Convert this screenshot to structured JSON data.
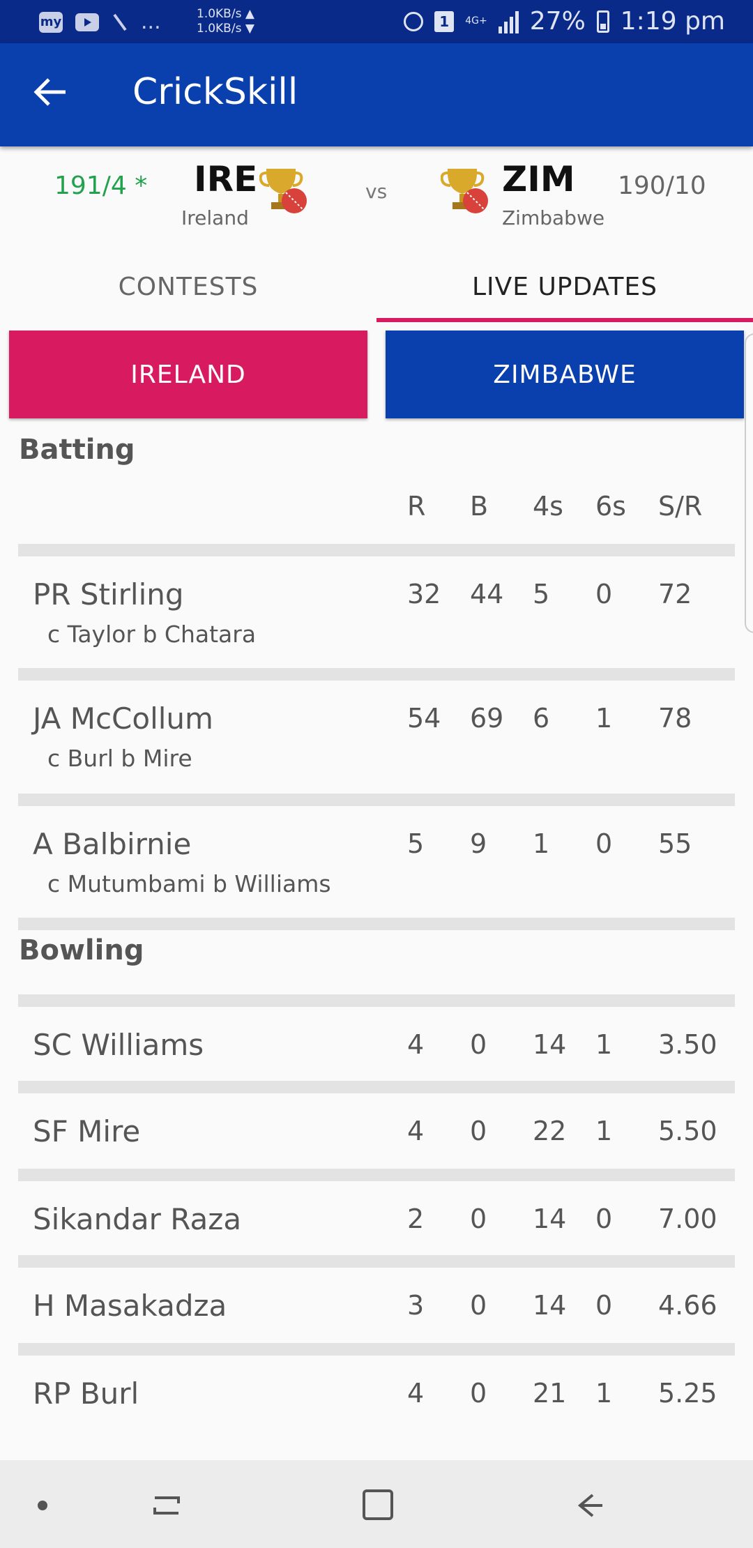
{
  "status_bar": {
    "app_badge": "my",
    "ellipsis": "...",
    "upload_speed": "1.0KB/s ▲",
    "download_speed": "1.0KB/s ▼",
    "sim_slot": "1",
    "network": "4G+",
    "battery": "27%",
    "time": "1:19 pm"
  },
  "app_bar": {
    "title": "CrickSkill"
  },
  "match": {
    "team1": {
      "score": "191/4 *",
      "code": "IRE",
      "name": "Ireland"
    },
    "vs": "vs",
    "team2": {
      "score": "190/10",
      "code": "ZIM",
      "name": "Zimbabwe"
    }
  },
  "tabs": [
    {
      "label": "CONTESTS",
      "active": false
    },
    {
      "label": "LIVE UPDATES",
      "active": true
    }
  ],
  "team_buttons": {
    "ireland": "IRELAND",
    "zimbabwe": "ZIMBABWE"
  },
  "batting": {
    "title": "Batting",
    "headers": [
      "R",
      "B",
      "4s",
      "6s",
      "S/R"
    ],
    "rows": [
      {
        "name": "PR Stirling",
        "dismissal": "c  Taylor b Chatara",
        "stats": [
          "32",
          "44",
          "5",
          "0",
          "72"
        ]
      },
      {
        "name": "JA McCollum",
        "dismissal": "c Burl b Mire",
        "stats": [
          "54",
          "69",
          "6",
          "1",
          "78"
        ]
      },
      {
        "name": "A Balbirnie",
        "dismissal": "c Mutumbami b Williams",
        "stats": [
          "5",
          "9",
          "1",
          "0",
          "55"
        ]
      }
    ]
  },
  "bowling": {
    "title": "Bowling",
    "rows": [
      {
        "name": "SC Williams",
        "stats": [
          "4",
          "0",
          "14",
          "1",
          "3.50"
        ]
      },
      {
        "name": "SF Mire",
        "stats": [
          "4",
          "0",
          "22",
          "1",
          "5.50"
        ]
      },
      {
        "name": "Sikandar Raza",
        "stats": [
          "2",
          "0",
          "14",
          "0",
          "7.00"
        ]
      },
      {
        "name": "H Masakadza",
        "stats": [
          "3",
          "0",
          "14",
          "0",
          "4.66"
        ]
      },
      {
        "name": "RP Burl",
        "stats": [
          "4",
          "0",
          "21",
          "1",
          "5.25"
        ]
      }
    ]
  },
  "colors": {
    "primary": "#0a3fae",
    "accent": "#d81b60",
    "score_green": "#23a24d"
  }
}
